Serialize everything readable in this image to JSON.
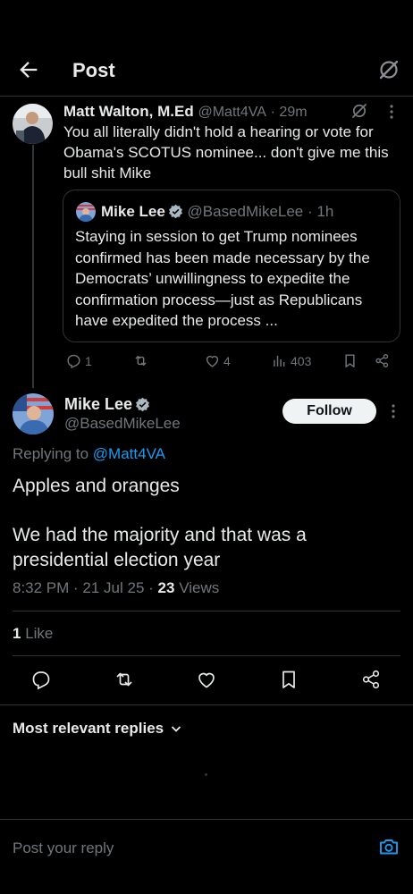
{
  "header": {
    "title": "Post"
  },
  "parent_tweet": {
    "name": "Matt Walton, M.Ed",
    "handle": "@Matt4VA",
    "time": "· 29m",
    "text": "You all literally didn't hold a hearing or vote for Obama's SCOTUS nominee... don't give me this bull shit Mike",
    "quote": {
      "name": "Mike Lee",
      "handle": "@BasedMikeLee",
      "time": "· 1h",
      "text": "Staying in session to get Trump nominees confirmed has been made necessary by the Democrats’ unwillingness to expedite the confirmation process—just as Republicans have expedited the process ..."
    },
    "replies": "1",
    "likes": "4",
    "views": "403"
  },
  "main_tweet": {
    "name": "Mike Lee",
    "handle": "@BasedMikeLee",
    "follow_label": "Follow",
    "replying_prefix": "Replying to",
    "replying_to": "@Matt4VA",
    "text_line1": "Apples and oranges",
    "text_line2": "We had the majority and that was a presidential election year",
    "timestamp": "8:32 PM · 21 Jul 25 · ",
    "views_count": "23",
    "views_label": "Views",
    "like_count": "1",
    "like_label": "Like"
  },
  "replies_sort": {
    "label": "Most relevant replies"
  },
  "reply_bar": {
    "placeholder": "Post your reply"
  },
  "colors": {
    "background": "#000000",
    "accent": "#1d9bf0",
    "muted": "#71767b",
    "divider": "#2f3336"
  }
}
